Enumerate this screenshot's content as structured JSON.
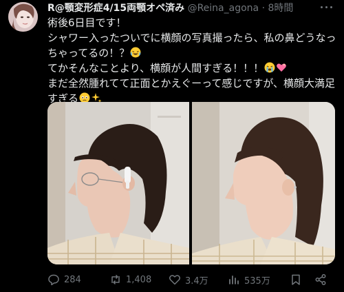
{
  "post": {
    "display_name": "R@顎変形症4/15両顎オペ済み",
    "handle": "@Reina_agona",
    "separator": "·",
    "time": "8時間",
    "text_lines": [
      "術後6日目です！",
      "シャワー入ったついでに横顔の写真撮ったら、私の鼻どうなっ",
      "ちゃってるの！？",
      "てかそんなことより、横顔が人間すぎる！！！",
      "まだ全然腫れてて正面とかえぐーって感じですが、横顔大満足",
      "すぎる"
    ],
    "emojis": [
      "rolling-on-floor-laughing",
      "loudly-crying",
      "sparkling-heart",
      "holding-back-tears",
      "sparkles"
    ]
  },
  "media": {
    "images": [
      "side-profile-photo-left",
      "side-profile-photo-right"
    ]
  },
  "actions": {
    "reply_count": "284",
    "repost_count": "1,408",
    "like_count": "3.4万",
    "view_count": "535万"
  },
  "colors": {
    "background": "#000000",
    "text_primary": "#e7e9ea",
    "text_secondary": "#71767b"
  }
}
